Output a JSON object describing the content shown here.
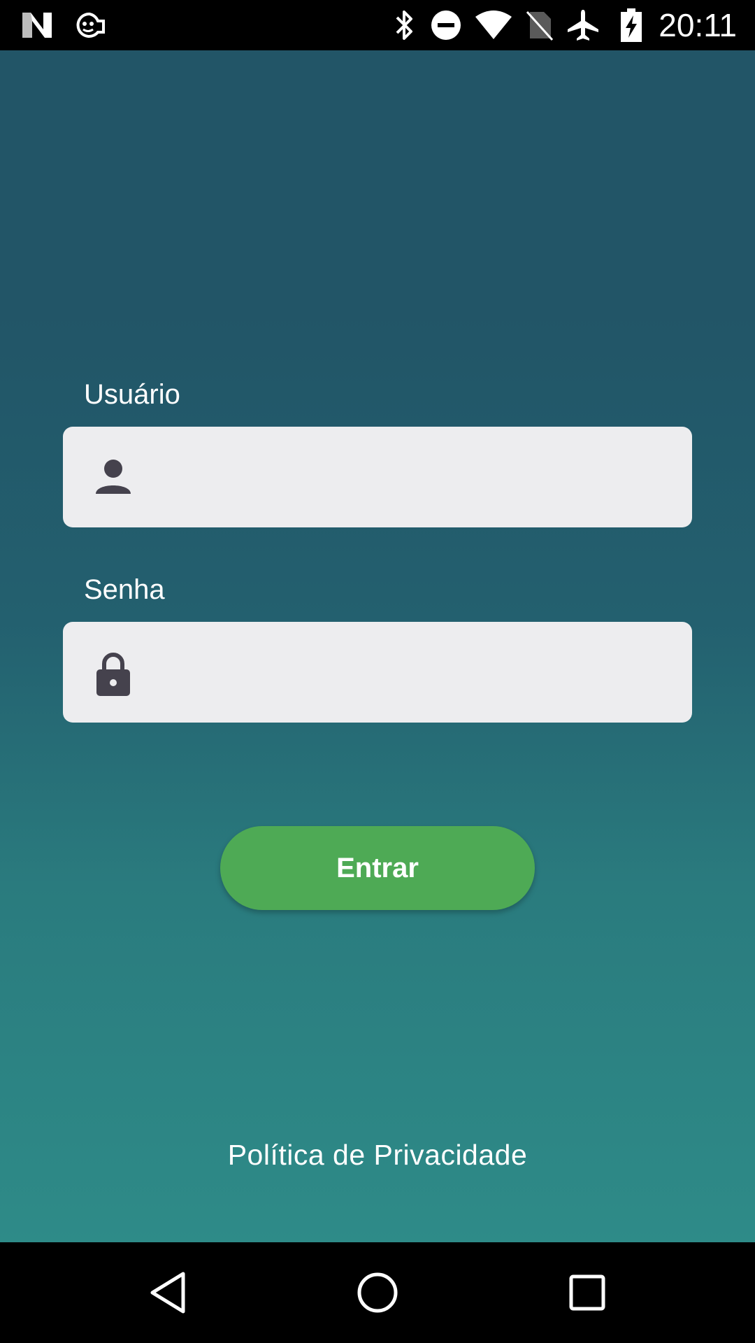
{
  "status_bar": {
    "time": "20:11",
    "left_icons": [
      "n-logo-icon",
      "robot-face-icon"
    ],
    "right_icons": [
      "bluetooth-icon",
      "do-not-disturb-icon",
      "wifi-icon",
      "no-sim-icon",
      "airplane-icon",
      "battery-charging-icon"
    ]
  },
  "login": {
    "username_label": "Usuário",
    "username_value": "",
    "password_label": "Senha",
    "password_value": "",
    "submit_label": "Entrar",
    "privacy_link": "Política de Privacidade"
  },
  "colors": {
    "gradient_top": "#225567",
    "gradient_bottom": "#2e8b88",
    "field_background": "#ededef",
    "button": "#4eaa55",
    "icon": "#45424d"
  },
  "nav_bar": {
    "buttons": [
      "back-icon",
      "home-icon",
      "recents-icon"
    ]
  }
}
